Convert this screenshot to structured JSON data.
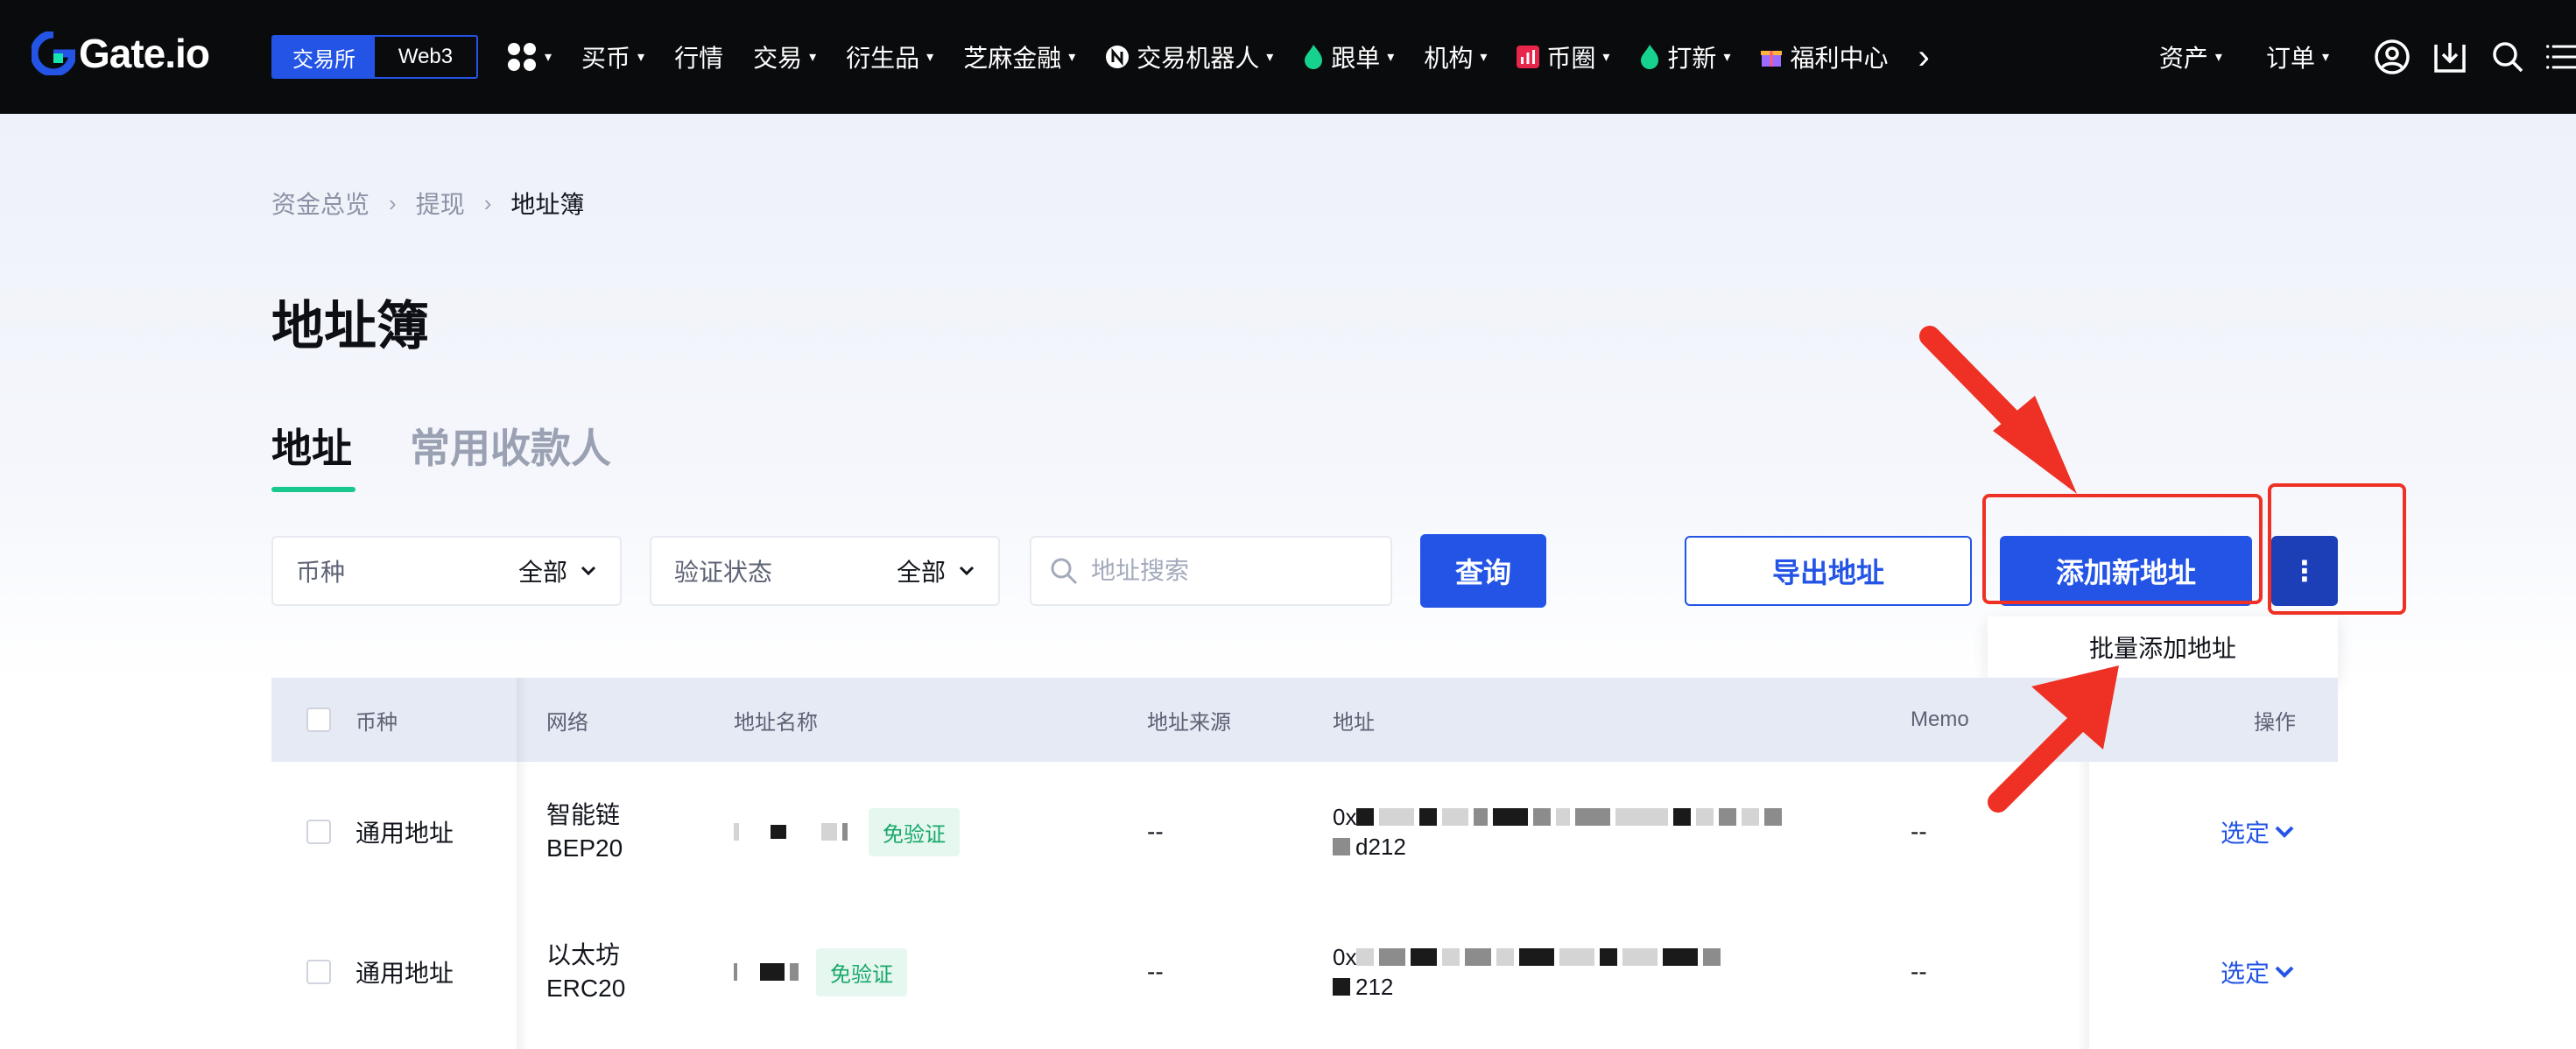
{
  "nav": {
    "logo_text": "Gate.io",
    "segment": [
      "交易所",
      "Web3"
    ],
    "items": [
      {
        "label": "买币",
        "caret": true
      },
      {
        "label": "行情",
        "caret": false
      },
      {
        "label": "交易",
        "caret": true
      },
      {
        "label": "衍生品",
        "caret": true
      },
      {
        "label": "芝麻金融",
        "caret": true
      },
      {
        "label": "交易机器人",
        "caret": true,
        "icon": "n-badge-icon"
      },
      {
        "label": "跟单",
        "caret": true,
        "icon": "flame-icon"
      },
      {
        "label": "机构",
        "caret": true
      },
      {
        "label": "币圈",
        "caret": true,
        "icon": "bar-chart-icon"
      },
      {
        "label": "打新",
        "caret": true,
        "icon": "flame-icon"
      },
      {
        "label": "福利中心",
        "caret": false,
        "icon": "gift-icon"
      }
    ],
    "right": [
      "资产",
      "订单"
    ],
    "caret_glyph": "▾",
    "more_glyph": "›"
  },
  "breadcrumb": [
    "资金总览",
    "提现",
    "地址簿"
  ],
  "breadcrumb_sep": "›",
  "page_title": "地址簿",
  "tabs": [
    "地址",
    "常用收款人"
  ],
  "filters": {
    "coin": {
      "label": "币种",
      "value": "全部"
    },
    "verify": {
      "label": "验证状态",
      "value": "全部"
    },
    "search_placeholder": "地址搜索"
  },
  "buttons": {
    "query": "查询",
    "export": "导出地址",
    "add_new": "添加新地址",
    "more": "⋮"
  },
  "dropdown": {
    "batch_add": "批量添加地址"
  },
  "table": {
    "headers": [
      "币种",
      "网络",
      "地址名称",
      "地址来源",
      "地址",
      "Memo",
      "操作"
    ],
    "rows": [
      {
        "coin": "通用地址",
        "network_line1": "智能链",
        "network_line2": "BEP20",
        "badge": "免验证",
        "source": "--",
        "address_prefix": "0x",
        "address_suffix": "d212",
        "memo": "--",
        "action": "选定"
      },
      {
        "coin": "通用地址",
        "network_line1": "以太坊",
        "network_line2": "ERC20",
        "badge": "免验证",
        "source": "--",
        "address_prefix": "0x",
        "address_suffix": "212",
        "memo": "--",
        "action": "选定"
      }
    ]
  },
  "colors": {
    "accent": "#2354e6",
    "highlight": "#ee3124",
    "success": "#18c98d"
  }
}
